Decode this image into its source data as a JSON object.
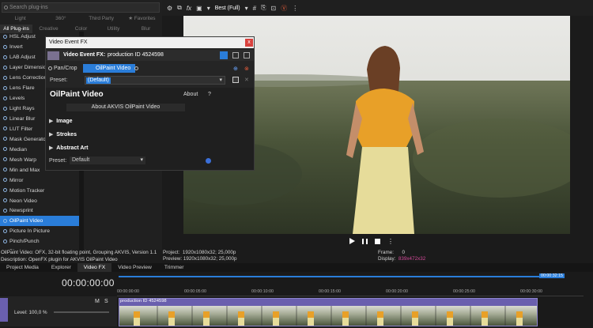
{
  "plugins": {
    "search_placeholder": "Search plug-ins",
    "cats1": [
      "Light",
      "360°",
      "Third Party",
      "Favorites"
    ],
    "cats2": [
      "All Plug-ins",
      "Creative",
      "Color",
      "Utility",
      "Blur"
    ],
    "items": [
      "HSL Adjust",
      "Invert",
      "LAB Adjust",
      "Layer Dimensions",
      "Lens Correction",
      "Lens Flare",
      "Levels",
      "Light Rays",
      "Linear Blur",
      "LUT Filter",
      "Mask Generator",
      "Median",
      "Mesh Warp",
      "Min and Max",
      "Mirror",
      "Motion Tracker",
      "Neon Video",
      "Newsprint",
      "OilPaint Video",
      "Picture In Picture",
      "Pinch/Punch",
      "Pixelate"
    ],
    "selected_index": 18,
    "desc_line1": "OilPaint Video: OFX, 32-bit floating point, Grouping AKVIS, Version 1.1",
    "desc_line2": "Description: OpenFX plugin for AKVIS OilPaint Video"
  },
  "dialog": {
    "title": "Video Event FX",
    "close": "x",
    "header_label": "Video Event FX:",
    "header_value": "production ID 4524598",
    "chain1": "Pan/Crop",
    "chain2": "OilPaint Video",
    "preset_label": "Preset:",
    "preset_value": "(Default)",
    "plugin_title": "OilPaint Video",
    "about": "About",
    "help": "?",
    "about_akvis": "About AKVIS OilPaint Video",
    "sections": [
      "Image",
      "Strokes",
      "Abstract Art"
    ],
    "preset2_label": "Preset:",
    "preset2_value": "Default"
  },
  "toolbar": {
    "quality": "Best (Full)"
  },
  "preview": {
    "project_label": "Project:",
    "project_value": "1920x1080x32; 25,000p",
    "preview_label": "Preview:",
    "preview_value": "1920x1080x32; 25,000p",
    "frame_label": "Frame:",
    "frame_value": "0",
    "display_label": "Display:",
    "display_value": "839x472x32"
  },
  "tabs": [
    "Project Media",
    "Explorer",
    "Video FX",
    "Video Preview",
    "Trimmer"
  ],
  "active_tab": "Video FX",
  "timeline": {
    "timecode": "00:00:00:00",
    "level": "Level: 100,0 %",
    "m": "M",
    "s": "S",
    "end_marker": "00:00:32:15",
    "ticks": [
      "00:00:00:00",
      "00:00:05:00",
      "00:00:10:00",
      "00:00:15:00",
      "00:00:20:00",
      "00:00:25:00",
      "00:00:30:00"
    ],
    "clip_label": "production ID 4524598"
  },
  "colors": {
    "accent": "#2a7dd9",
    "clip": "#6a5fae",
    "close": "#d9413d"
  }
}
